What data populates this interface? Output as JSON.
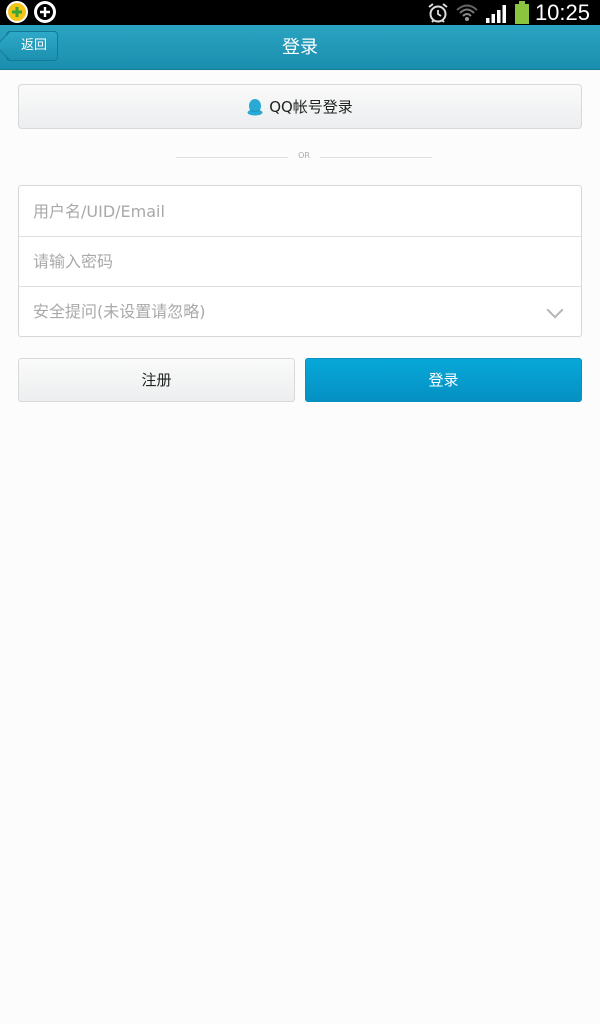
{
  "status_bar": {
    "time": "10:25",
    "icons": [
      "app-notification-icon",
      "app-notification-icon",
      "alarm-icon",
      "wifi-icon",
      "signal-icon",
      "battery-icon"
    ]
  },
  "header": {
    "back_label": "返回",
    "title": "登录"
  },
  "qq_login": {
    "label": "QQ帐号登录",
    "icon": "qq-penguin-icon"
  },
  "divider": {
    "text": "OR"
  },
  "form": {
    "username_placeholder": "用户名/UID/Email",
    "password_placeholder": "请输入密码",
    "security_question_value": "安全提问(未设置请忽略)"
  },
  "actions": {
    "register_label": "注册",
    "login_label": "登录"
  },
  "colors": {
    "header": "#1f97b6",
    "primary_button": "#069bd0",
    "qq_icon": "#29a9d6"
  }
}
